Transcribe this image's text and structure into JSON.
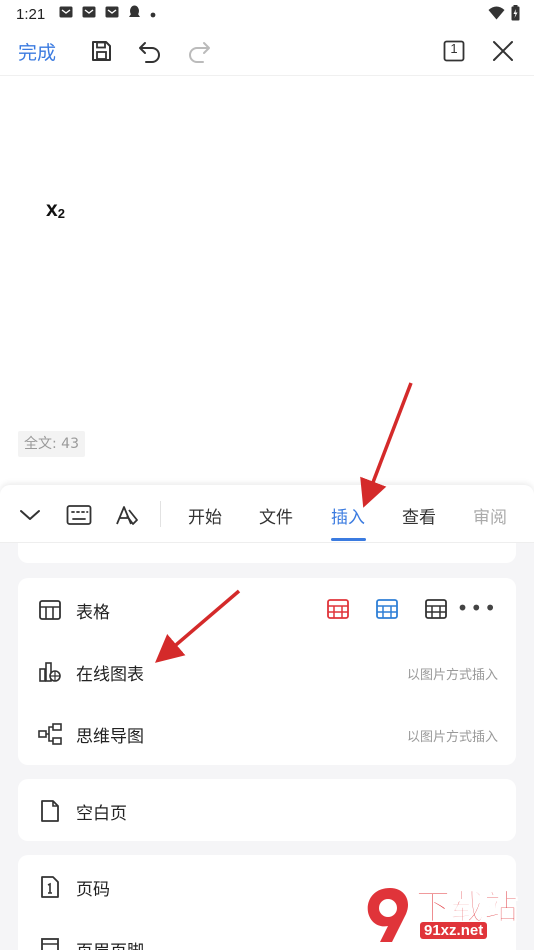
{
  "status_bar": {
    "time": "1:21",
    "icons": [
      "mail-icon",
      "mail-icon",
      "mail-icon",
      "qq-icon",
      "dot-icon"
    ],
    "right_icons": [
      "wifi-icon",
      "battery-icon"
    ]
  },
  "toolbar": {
    "done_label": "完成",
    "page_count": "1",
    "icons": [
      "save-icon",
      "undo-icon",
      "redo-icon",
      "page-count-icon",
      "close-icon"
    ]
  },
  "document": {
    "text_main": "x",
    "text_sub": "2",
    "word_count": "全文: 43"
  },
  "ribbon": {
    "tabs": [
      {
        "label": "开始"
      },
      {
        "label": "文件"
      },
      {
        "label": "插入"
      },
      {
        "label": "查看"
      },
      {
        "label": "审阅"
      }
    ],
    "active_tab": "插入",
    "accent_color": "#3b7be0"
  },
  "insert_panel": {
    "table": {
      "label": "表格",
      "options": [
        "red-table-icon",
        "blue-table-icon",
        "black-table-icon"
      ],
      "more": "•••"
    },
    "online_chart": {
      "label": "在线图表",
      "hint": "以图片方式插入"
    },
    "mind_map": {
      "label": "思维导图",
      "hint": "以图片方式插入"
    },
    "blank_page": {
      "label": "空白页"
    },
    "page_number": {
      "label": "页码"
    },
    "header_footer": {
      "label": "页眉页脚"
    }
  },
  "watermark": {
    "big_text": "下载站",
    "small_text": "91xz.net"
  }
}
